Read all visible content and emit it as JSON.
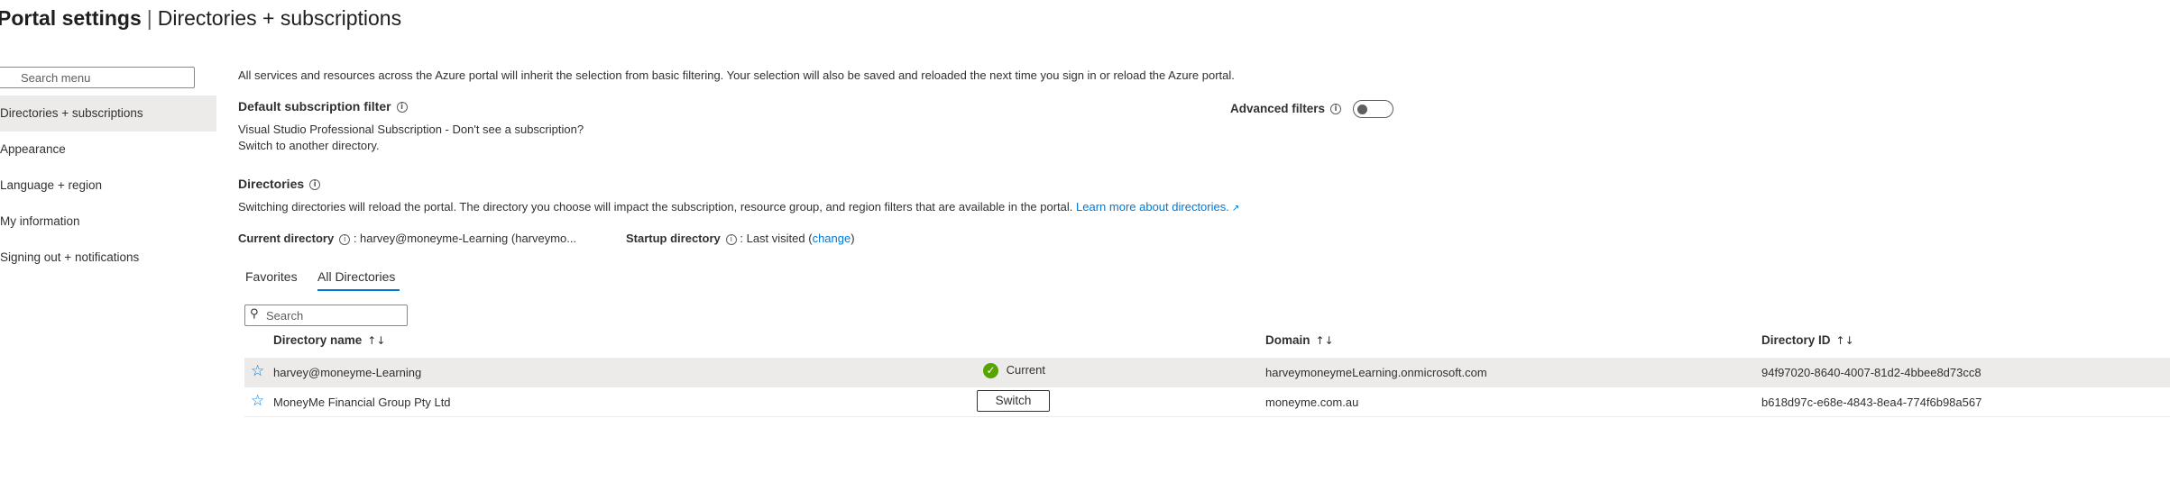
{
  "header": {
    "title": "Portal settings",
    "separator": "|",
    "subtitle": "Directories + subscriptions"
  },
  "sidebar": {
    "search_placeholder": "Search menu",
    "items": [
      {
        "label": "Directories + subscriptions",
        "selected": true
      },
      {
        "label": "Appearance"
      },
      {
        "label": "Language + region"
      },
      {
        "label": "My information"
      },
      {
        "label": "Signing out + notifications"
      }
    ]
  },
  "main": {
    "intro": "All services and resources across the Azure portal will inherit the selection from basic filtering. Your selection will also be saved and reloaded the next time you sign in or reload the Azure portal.",
    "default_filter": {
      "heading": "Default subscription filter",
      "line1": "Visual Studio Professional Subscription - Don't see a subscription?",
      "line2": "Switch to another directory."
    },
    "advanced_filters": {
      "label": "Advanced filters",
      "enabled": false
    },
    "directories": {
      "heading": "Directories",
      "description": "Switching directories will reload the portal. The directory you choose will impact the subscription, resource group, and region filters that are available in the portal.",
      "learn_more": "Learn more about directories.",
      "current_label": "Current directory",
      "current_value": ": harvey@moneyme-Learning (harveymo...",
      "startup_label": "Startup directory",
      "startup_value": ": Last visited (",
      "startup_change": "change",
      "startup_close": ")"
    },
    "tabs": [
      {
        "label": "Favorites"
      },
      {
        "label": "All Directories",
        "active": true
      }
    ],
    "table": {
      "search_placeholder": "Search",
      "columns": {
        "name": "Directory name",
        "domain": "Domain",
        "id": "Directory ID"
      },
      "rows": [
        {
          "name": "harvey@moneyme-Learning",
          "status": "Current",
          "domain": "harveymoneymeLearning.onmicrosoft.com",
          "id": "94f97020-8640-4007-81d2-4bbee8d73cc8"
        },
        {
          "name": "MoneyMe Financial Group Pty Ltd",
          "action": "Switch",
          "domain": "moneyme.com.au",
          "id": "b618d97c-e68e-4843-8ea4-774f6b98a567"
        }
      ]
    }
  },
  "colors": {
    "accent": "#0078d4",
    "selected_bg": "#edebe9",
    "success": "#57a300"
  }
}
